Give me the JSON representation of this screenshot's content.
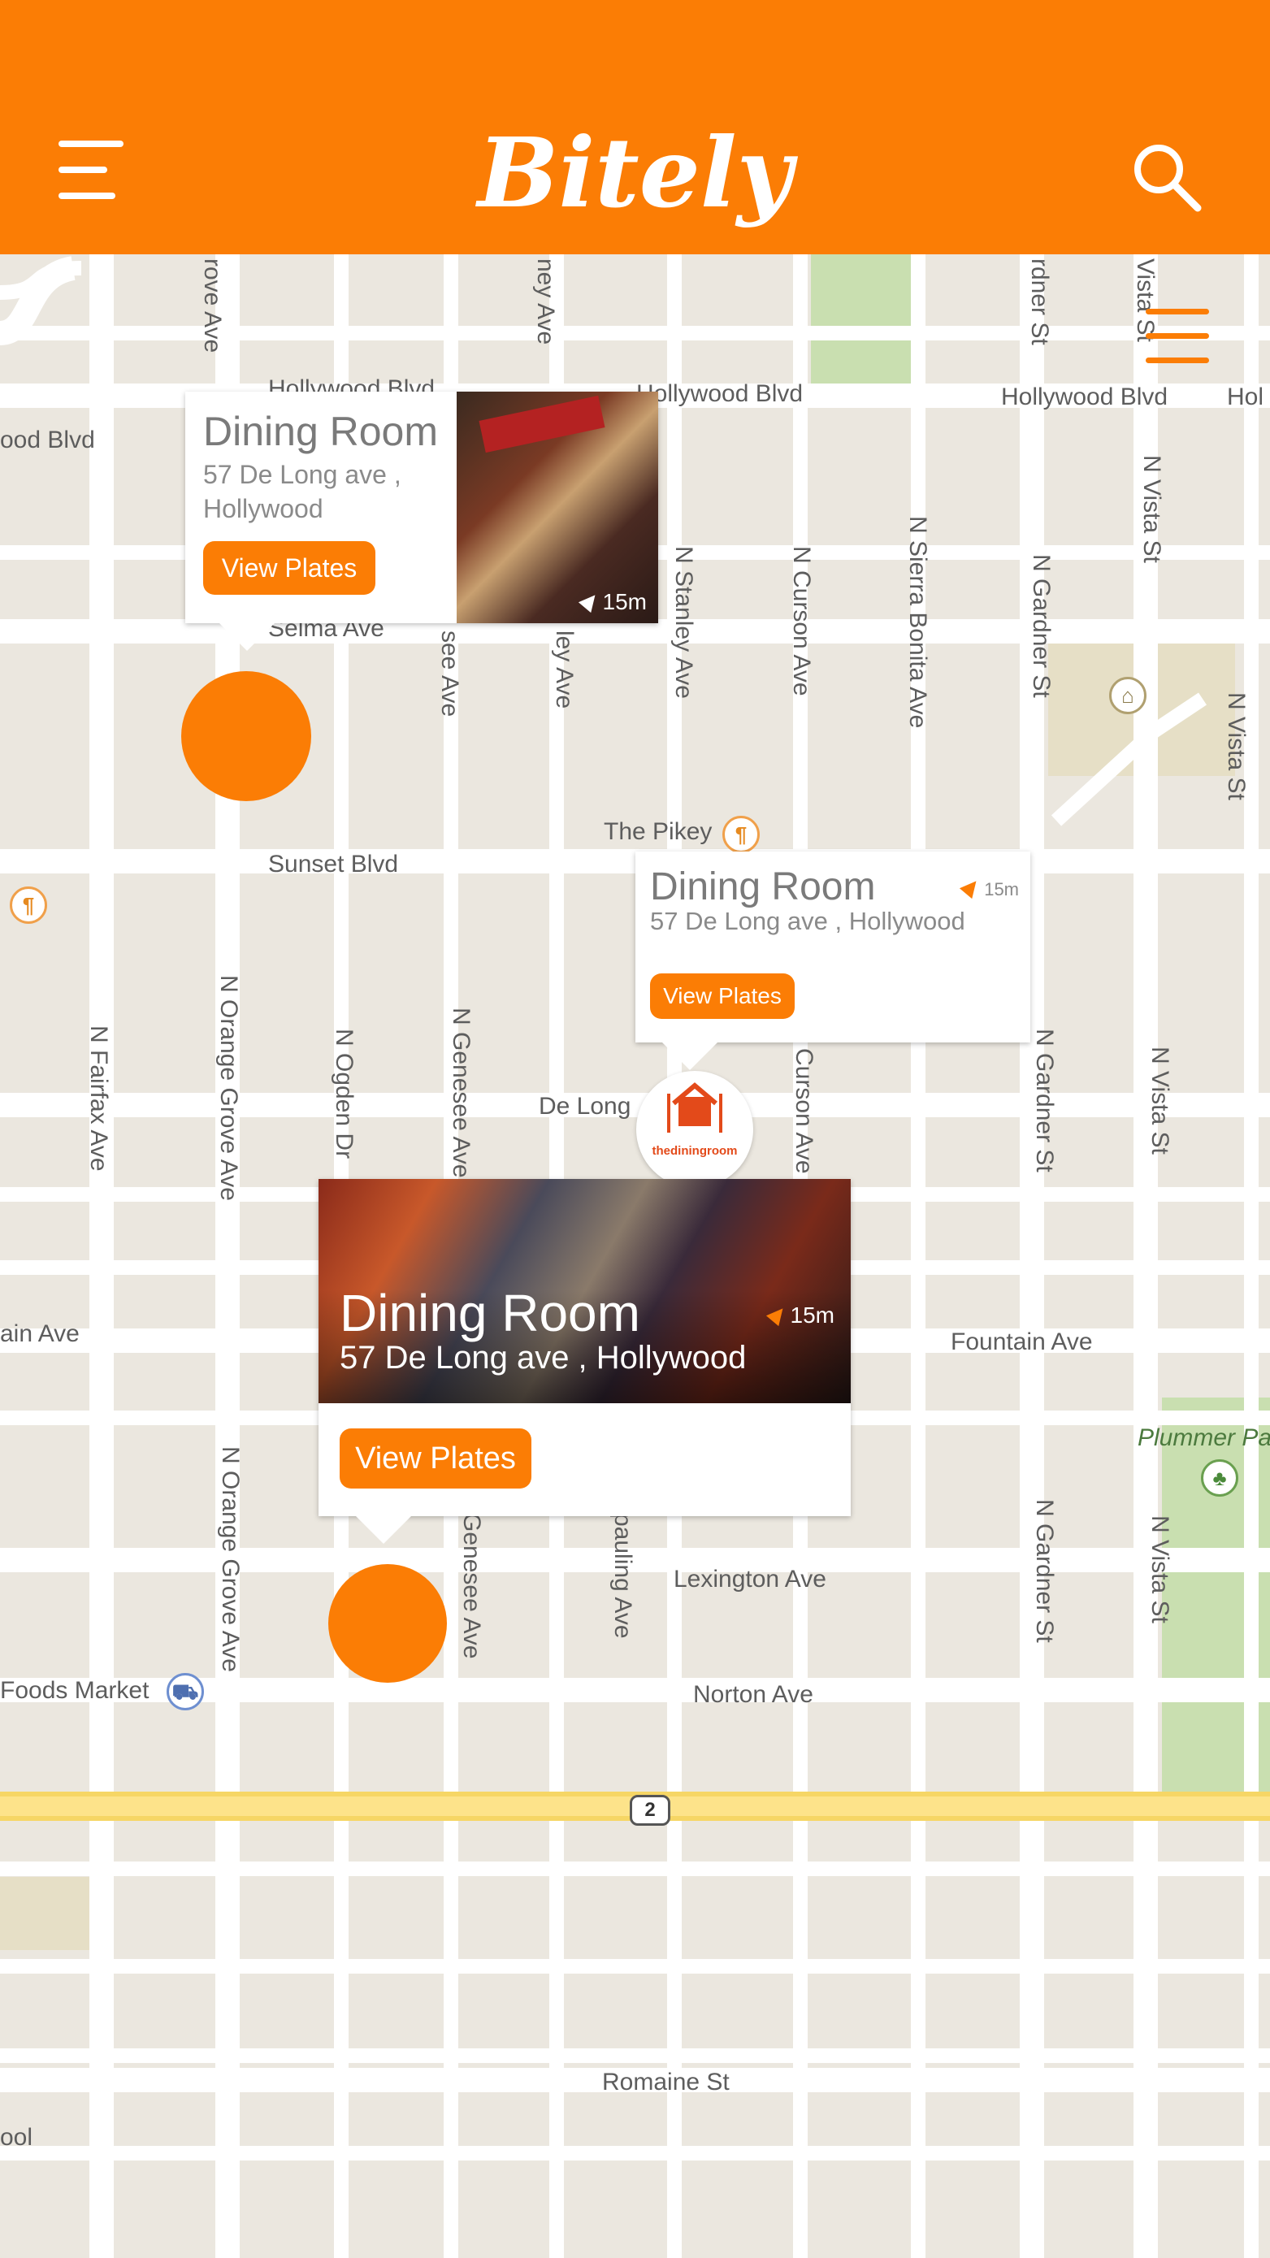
{
  "app": {
    "name": "Bitely"
  },
  "header": {
    "menu_icon": "hamburger-icon",
    "search_icon": "search-icon",
    "accent": "#fb7d05"
  },
  "map": {
    "labels": [
      {
        "text": "Hollywood Blvd"
      },
      {
        "text": "Hollywood Blvd"
      },
      {
        "text": "ood Blvd"
      },
      {
        "text": "Hollywood Blvd"
      },
      {
        "text": "Hol"
      },
      {
        "text": "Selma Ave"
      },
      {
        "text": "The Pikey"
      },
      {
        "text": "Sunset Blvd"
      },
      {
        "text": "De Long"
      },
      {
        "text": "ain Ave"
      },
      {
        "text": "Fountain Ave"
      },
      {
        "text": "Plummer Pa"
      },
      {
        "text": "Lexington Ave"
      },
      {
        "text": "Norton Ave"
      },
      {
        "text": "Foods Market"
      },
      {
        "text": "Romaine St"
      },
      {
        "text": "ool"
      }
    ],
    "vlabels": [
      {
        "text": "rove Ave"
      },
      {
        "text": "ney Ave"
      },
      {
        "text": "rdner St"
      },
      {
        "text": "Vista St"
      },
      {
        "text": "N Vista St"
      },
      {
        "text": "N Stanley Ave"
      },
      {
        "text": "N Curson Ave"
      },
      {
        "text": "N Sierra Bonita Ave"
      },
      {
        "text": "N Gardner St"
      },
      {
        "text": "N Vista St"
      },
      {
        "text": "see Ave"
      },
      {
        "text": "ley Ave"
      },
      {
        "text": "N Fairfax Ave"
      },
      {
        "text": "N Orange Grove Ave"
      },
      {
        "text": "N Ogden Dr"
      },
      {
        "text": "N Genesee Ave"
      },
      {
        "text": "Curson Ave"
      },
      {
        "text": "N Gardner St"
      },
      {
        "text": "N Vista St"
      },
      {
        "text": "N Orange Grove Ave"
      },
      {
        "text": "N Gardner St"
      },
      {
        "text": "N Vista St"
      },
      {
        "text": "Genesee Ave"
      },
      {
        "text": "pauling Ave"
      }
    ],
    "route_badge": "2"
  },
  "cards": [
    {
      "title": "Dining Room",
      "address_line1": "57 De Long ave ,",
      "address_line2": "Hollywood",
      "button": "View Plates",
      "distance": "15m"
    },
    {
      "title": "Dining Room",
      "address": "57 De Long ave , Hollywood",
      "button": "View Plates",
      "distance": "15m"
    },
    {
      "title": "Dining Room",
      "address": "57 De Long ave , Hollywood",
      "button": "View Plates",
      "distance": "15m"
    }
  ],
  "restaurant_pin": {
    "logo_text": "thediningroom"
  }
}
